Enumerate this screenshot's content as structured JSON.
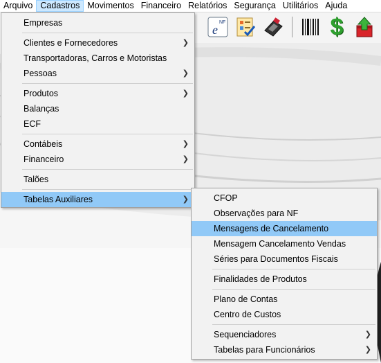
{
  "menubar": {
    "items": [
      "Arquivo",
      "Cadastros",
      "Movimentos",
      "Financeiro",
      "Relatórios",
      "Segurança",
      "Utilitários",
      "Ajuda"
    ],
    "active": "Cadastros"
  },
  "toolbar": {
    "icons": [
      "nfe-icon",
      "checklist-icon",
      "card-machine-icon",
      "barcode-icon",
      "dollar-icon",
      "upload-box-icon"
    ],
    "nfe_text": "NF",
    "dollar_text": "$"
  },
  "cadastros_menu": {
    "empresas": "Empresas",
    "clientes": "Clientes e Fornecedores",
    "transportadoras": "Transportadoras, Carros e Motoristas",
    "pessoas": "Pessoas",
    "produtos": "Produtos",
    "balancas": "Balanças",
    "ecf": "ECF",
    "contabeis": "Contábeis",
    "financeiro": "Financeiro",
    "taloes": "Talões",
    "tabelas_aux": "Tabelas Auxiliares"
  },
  "tabelas_menu": {
    "cfop": "CFOP",
    "obs_nf": "Observações para NF",
    "msg_cancel": "Mensagens de Cancelamento",
    "msg_cancel_vendas": "Mensagem Cancelamento Vendas",
    "series": "Séries para Documentos Fiscais",
    "finalidades": "Finalidades de Produtos",
    "plano_contas": "Plano de Contas",
    "centro_custos": "Centro de Custos",
    "sequenciadores": "Sequenciadores",
    "tabelas_func": "Tabelas para Funcionários"
  },
  "colors": {
    "highlight": "#91c9f7",
    "menubar_active": "#cce8ff",
    "menu_bg": "#f2f2f2",
    "dollar_green": "#2ea02e",
    "box_red": "#d9242a"
  }
}
